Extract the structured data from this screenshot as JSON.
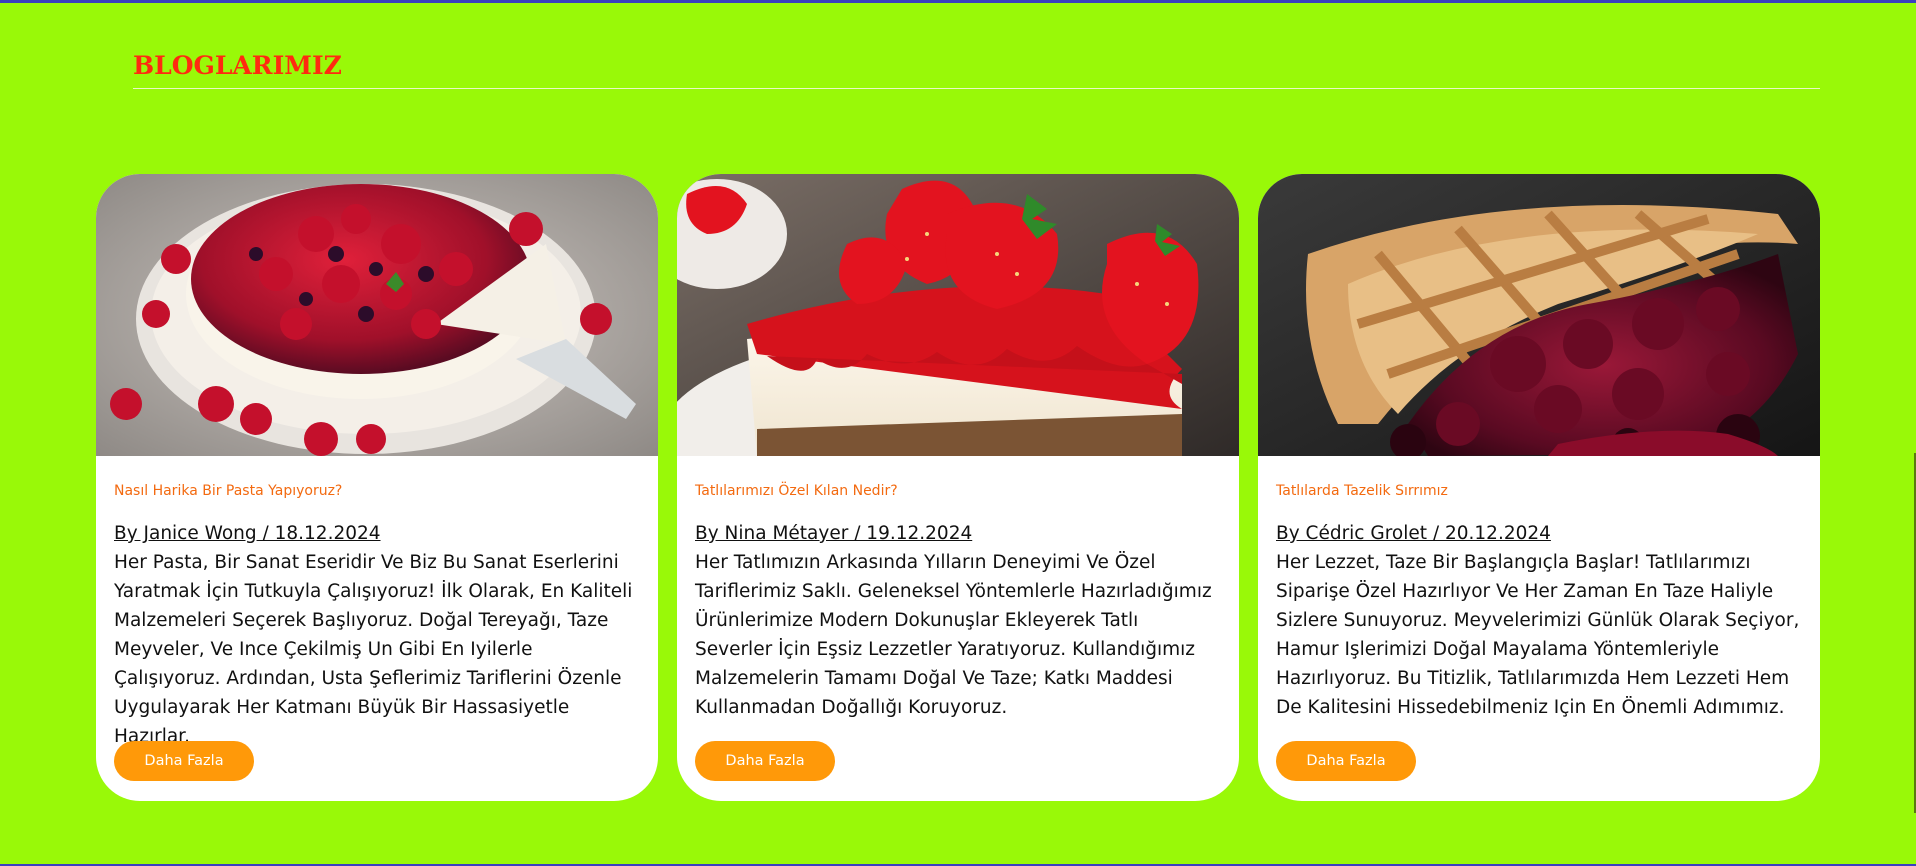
{
  "section": {
    "title": "BLOGLARIMIZ"
  },
  "colors": {
    "background": "#99f908",
    "title": "#ff2a10",
    "category": "#f36a10",
    "button": "#ff9909",
    "card": "#ffffff"
  },
  "posts": [
    {
      "image": "raspberry-blackberry-cheesecake",
      "category": "Nasıl Harika Bir Pasta Yapıyoruz?",
      "meta": "By Janice Wong / 18.12.2024",
      "text": "Her Pasta, Bir Sanat Eseridir Ve Biz Bu Sanat Eserlerini Yaratmak İçin Tutkuyla Çalışıyoruz! İlk Olarak, En Kaliteli Malzemeleri Seçerek Başlıyoruz. Doğal Tereyağı, Taze Meyveler, Ve Ince Çekilmiş Un Gibi En Iyilerle Çalışıyoruz. Ardından, Usta Şeflerimiz Tariflerini Özenle Uygulayarak Her Katmanı Büyük Bir Hassasiyetle Hazırlar.",
      "button": "Daha Fazla"
    },
    {
      "image": "strawberry-cheesecake-slice",
      "category": "Tatlılarımızı Özel Kılan Nedir?",
      "meta": "By Nina Métayer / 19.12.2024",
      "text": "Her Tatlımızın Arkasında Yılların Deneyimi Ve Özel Tariflerimiz Saklı. Geleneksel Yöntemlerle Hazırladığımız Ürünlerimize Modern Dokunuşlar Ekleyerek Tatlı Severler İçin Eşsiz Lezzetler Yaratıyoruz. Kullandığımız Malzemelerin Tamamı Doğal Ve Taze; Katkı Maddesi Kullanmadan Doğallığı Koruyoruz.",
      "button": "Daha Fazla"
    },
    {
      "image": "cherry-lattice-pie",
      "category": "Tatlılarda Tazelik Sırrımız",
      "meta": "By Cédric Grolet / 20.12.2024",
      "text": "Her Lezzet, Taze Bir Başlangıçla Başlar! Tatlılarımızı Siparişe Özel Hazırlıyor Ve Her Zaman En Taze Haliyle Sizlere Sunuyoruz. Meyvelerimizi Günlük Olarak Seçiyor, Hamur Işlerimizi Doğal Mayalama Yöntemleriyle Hazırlıyoruz. Bu Titizlik, Tatlılarımızda Hem Lezzeti Hem De Kalitesini Hissedebilmeniz Için En Önemli Adımımız.",
      "button": "Daha Fazla"
    }
  ]
}
